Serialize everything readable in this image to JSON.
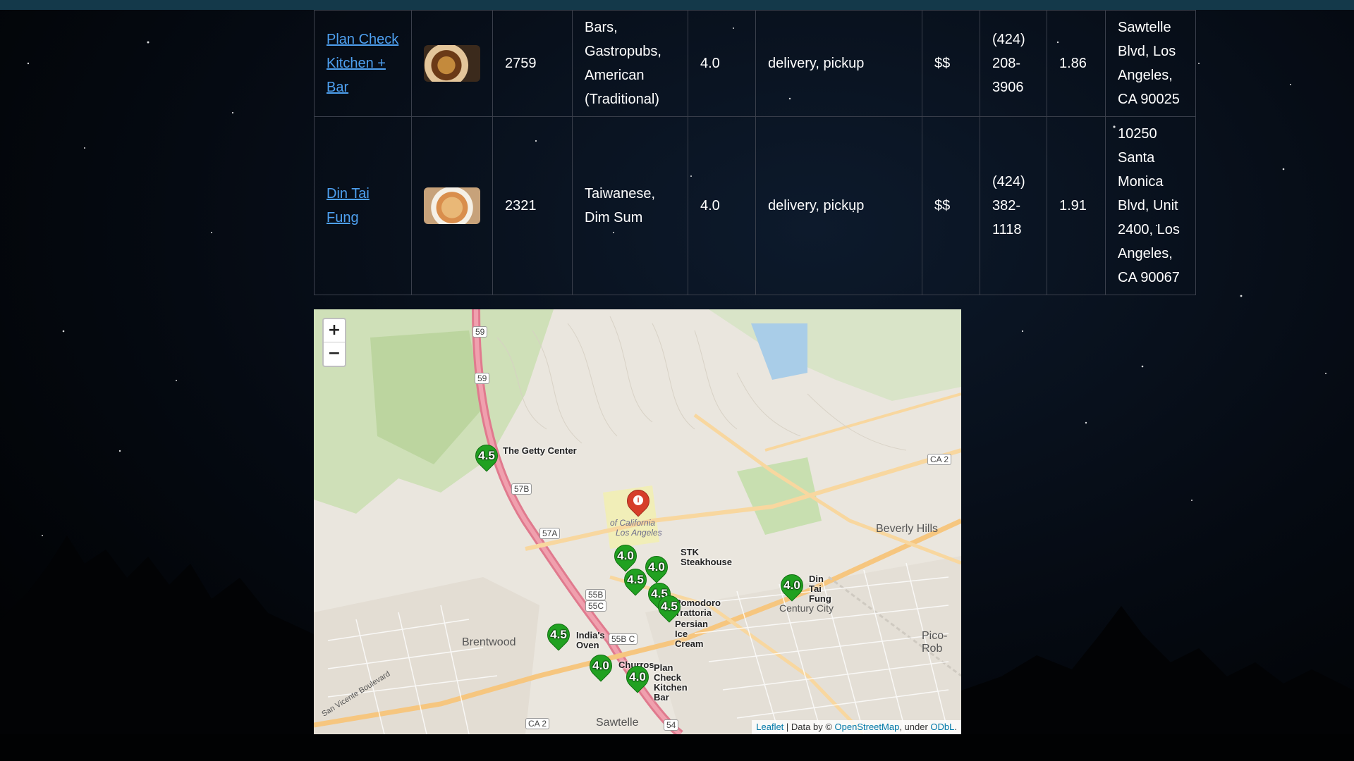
{
  "results": [
    {
      "name": "Plan Check Kitchen + Bar",
      "image": "burger-thumbnail",
      "review_count": "2759",
      "categories": "Bars, Gastropubs, American (Traditional)",
      "rating": "4.0",
      "transactions": "delivery, pickup",
      "price": "$$",
      "phone": "(424) 208-3906",
      "distance": "1.86",
      "address": "Sawtelle Blvd, Los Angeles, CA 90025"
    },
    {
      "name": "Din Tai Fung",
      "image": "noodle-bowl-thumbnail",
      "review_count": "2321",
      "categories": "Taiwanese, Dim Sum",
      "rating": "4.0",
      "transactions": "delivery, pickup",
      "price": "$$",
      "phone": "(424) 382-1118",
      "distance": "1.91",
      "address": "10250 Santa Monica Blvd, Unit 2400, Los Angeles, CA 90067"
    }
  ],
  "map": {
    "zoom_in": "+",
    "zoom_out": "−",
    "attribution": {
      "leaflet": "Leaflet",
      "separator": " | Data by © ",
      "osm": "OpenStreetMap",
      "under": ", under ",
      "odbl": "ODbL",
      "end": "."
    },
    "places": [
      "Beverly Hills",
      "Century City",
      "Brentwood",
      "Sawtelle",
      "Pico-Rob",
      "Los Angeles",
      "of California",
      "San Vicente Boulevard"
    ],
    "route_shields": [
      "59",
      "59",
      "57B",
      "57A",
      "55B",
      "55C",
      "55B C",
      "CA 2",
      "CA 2",
      "54"
    ],
    "markers": [
      {
        "label": "The Getty Center",
        "rating": "4.5"
      },
      {
        "label": "Din Tai Fung",
        "rating": "4.0"
      },
      {
        "label": "India's Oven",
        "rating": "4.5"
      },
      {
        "label": "Churros",
        "rating": "4.0"
      },
      {
        "label": "Plan Check Kitchen + Bar",
        "rating": "4.0"
      },
      {
        "label": "STK Steakhouse",
        "rating": "4.0"
      },
      {
        "label": "Pomodoro Trattoria",
        "rating": "4.5"
      },
      {
        "label": "Persian Ice Cream",
        "rating": "4.5"
      }
    ],
    "poi_labels": {
      "getty": "The Getty Center",
      "din": "Din Tai Fung",
      "india": "India's Oven",
      "churros": "Churros",
      "plan": "Plan Check Kitchen Bar",
      "stk": "STK Steakhouse",
      "pomodoro": "Pomodoro Trattoria",
      "persian": "Persian Ice Cream"
    }
  }
}
